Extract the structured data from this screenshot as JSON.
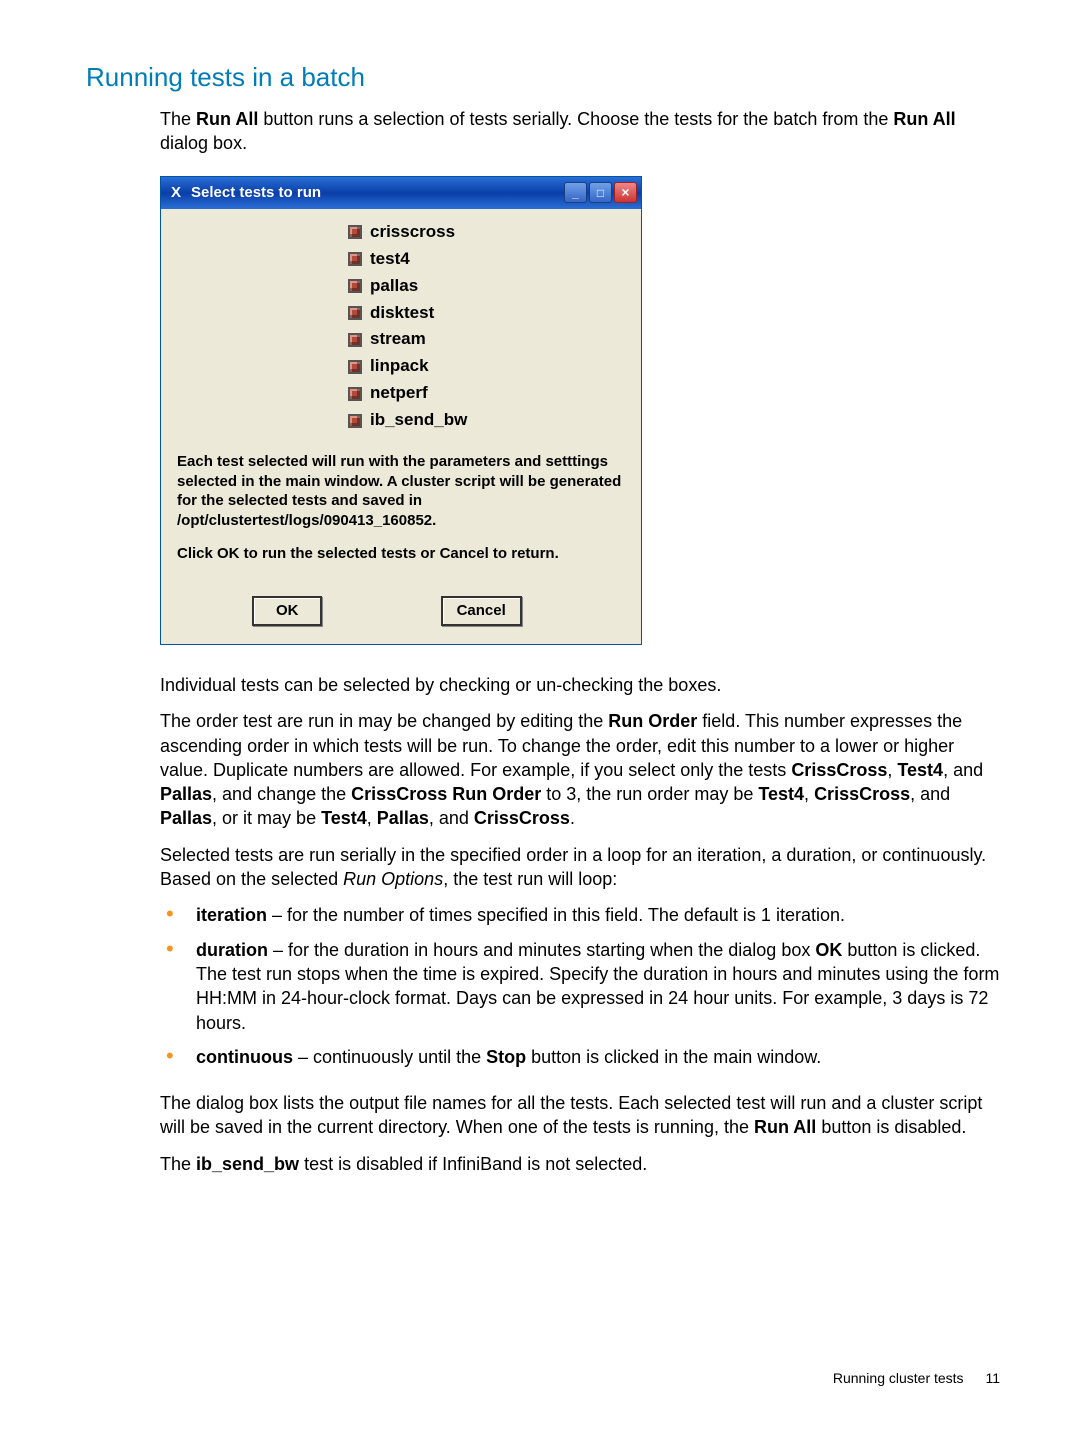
{
  "section_title": "Running tests in a batch",
  "intro": {
    "p1a": "The ",
    "runall1": "Run All",
    "p1b": " button runs a selection of tests serially. Choose the tests for the batch from the ",
    "runall2": "Run All",
    "p1c": " dialog box."
  },
  "dialog": {
    "title": "Select tests to run",
    "checks": [
      "crisscross",
      "test4",
      "pallas",
      "disktest",
      "stream",
      "linpack",
      "netperf",
      "ib_send_bw"
    ],
    "msg_p1": "Each test selected  will run with the parameters and setttings selected in the main window.  A cluster script will be generated for the selected tests and saved in /opt/clustertest/logs/090413_160852.",
    "msg_p2": "Click OK to run the selected tests or Cancel to return.",
    "ok": "OK",
    "cancel": "Cancel"
  },
  "after": {
    "p1": "Individual tests can be selected by checking or un-checking the boxes.",
    "p2a": "The order test are run in may be changed by editing the ",
    "p2_runorder": "Run Order",
    "p2b": " field. This number expresses the ascending order in which tests will be run. To change the order, edit this number to a lower or higher value. Duplicate numbers are allowed. For example, if you select only the tests ",
    "p2_cc": "CrissCross",
    "p2c": ", ",
    "p2_t4": "Test4",
    "p2d": ", and ",
    "p2_pal": "Pallas",
    "p2e": ", and change the ",
    "p2_ccro": "CrissCross Run Order",
    "p2f": " to 3, the run order may be ",
    "p2_t4b": "Test4",
    "p2g": ", ",
    "p2_ccb": "CrissCross",
    "p2h": ", and ",
    "p2_palb": "Pallas",
    "p2i": ", or it may be ",
    "p2_t4c": "Test4",
    "p2j": ", ",
    "p2_palc": "Pallas",
    "p2k": ", and ",
    "p2_ccc": "CrissCross",
    "p2l": ".",
    "p3a": "Selected tests are run serially in the specified order in a loop for an iteration, a duration, or continuously. Based on the selected ",
    "p3_ro": "Run Options",
    "p3b": ", the test run will loop:"
  },
  "bullets": {
    "b1_key": "iteration",
    "b1_txt": " – for the number of times specified in this field. The default is 1 iteration.",
    "b2_key": "duration",
    "b2_a": " – for the duration in hours and minutes starting when the dialog box ",
    "b2_ok": "OK",
    "b2_b": " button is clicked. The test run stops when the time is expired. Specify the duration in hours and minutes using the form HH:MM in 24-hour-clock format. Days can be expressed in 24 hour units. For example, 3 days is 72 hours.",
    "b3_key": "continuous",
    "b3_a": " – continuously until the ",
    "b3_stop": "Stop",
    "b3_b": " button is clicked in the main window."
  },
  "tail": {
    "p1a": "The dialog box lists the output file names for all the tests. Each selected test will run and a cluster script will be saved in the current directory. When one of the tests is running, the ",
    "p1_runall": "Run All",
    "p1b": " button is disabled.",
    "p2a": "The ",
    "p2_ib": "ib_send_bw",
    "p2b": " test is disabled if InfiniBand is not selected."
  },
  "footer": {
    "text": "Running cluster tests",
    "page": "11"
  }
}
